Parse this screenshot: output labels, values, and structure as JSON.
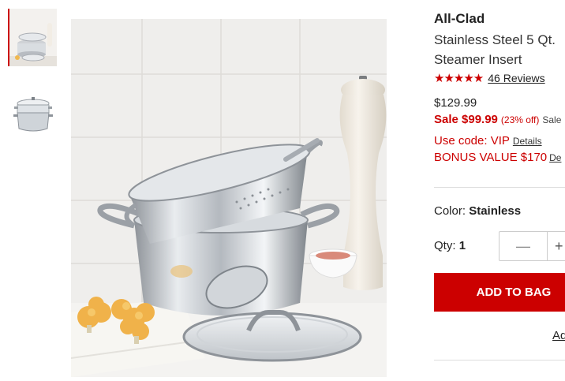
{
  "gallery": {
    "thumbnails": [
      {
        "name": "pot-with-steamer-and-lid",
        "selected": true
      },
      {
        "name": "assembled-pot-with-lid",
        "selected": false
      }
    ],
    "main_image": "stainless-stock-pot-with-steamer-insert-and-lid"
  },
  "product": {
    "brand": "All-Clad",
    "title_line1": "Stainless Steel 5 Qt.",
    "title_line2": "Steamer Insert",
    "stars": "★★★★★",
    "rating": 5,
    "reviews_label": "46 Reviews",
    "original_price": "$129.99",
    "sale_price": "Sale $99.99",
    "discount": "(23% off)",
    "sale_tail": "Sale",
    "promo_text": "Use code: VIP",
    "promo_link": "Details",
    "bonus_text": "BONUS VALUE $170",
    "bonus_link": "De"
  },
  "options": {
    "color_label": "Color:",
    "color_value": "Stainless",
    "qty_label": "Qty:",
    "qty_value": "1",
    "minus_symbol": "—",
    "plus_symbol": "+"
  },
  "actions": {
    "add_to_bag": "ADD TO BAG",
    "secondary_link": "Ad"
  },
  "colors": {
    "accent": "#cc0000"
  }
}
